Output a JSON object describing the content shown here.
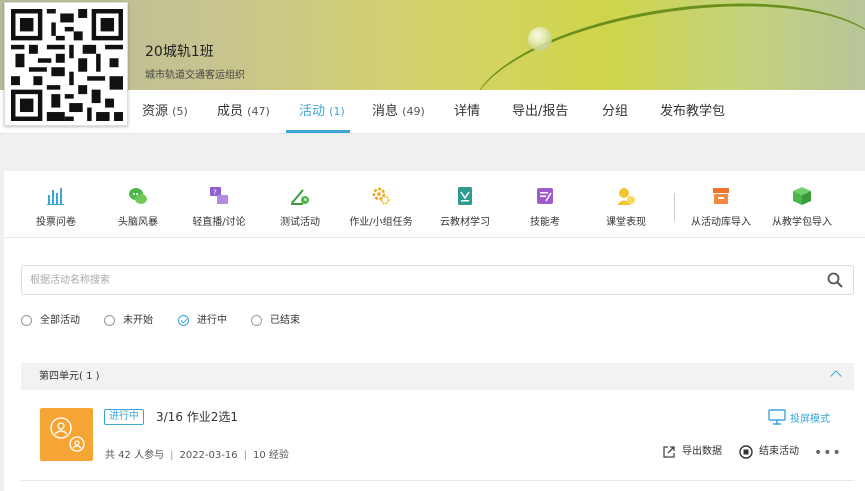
{
  "course": {
    "class_name": "20城轨1班",
    "subtitle": "城市轨道交通客运组织"
  },
  "nav": [
    {
      "label": "资源",
      "count": "(5)"
    },
    {
      "label": "成员",
      "count": "(47)"
    },
    {
      "label": "活动",
      "count": "(1)"
    },
    {
      "label": "消息",
      "count": "(49)"
    },
    {
      "label": "详情",
      "count": ""
    },
    {
      "label": "导出/报告",
      "count": ""
    },
    {
      "label": "分组",
      "count": ""
    },
    {
      "label": "发布教学包",
      "count": ""
    }
  ],
  "active_nav": "活动",
  "tools": [
    {
      "label": "投票问卷",
      "icon": "vote-icon"
    },
    {
      "label": "头脑风暴",
      "icon": "brainstorm-icon"
    },
    {
      "label": "轻直播/讨论",
      "icon": "live-discussion-icon"
    },
    {
      "label": "测试活动",
      "icon": "test-icon"
    },
    {
      "label": "作业/小组任务",
      "icon": "homework-icon"
    },
    {
      "label": "云教材学习",
      "icon": "cloud-textbook-icon"
    },
    {
      "label": "技能考",
      "icon": "skill-exam-icon"
    },
    {
      "label": "课堂表现",
      "icon": "class-performance-icon"
    },
    {
      "label": "从活动库导入",
      "icon": "activity-library-icon"
    },
    {
      "label": "从教学包导入",
      "icon": "teaching-package-icon"
    }
  ],
  "search": {
    "placeholder": "根据活动名称搜索"
  },
  "filters": [
    {
      "label": "全部活动",
      "checked": false
    },
    {
      "label": "未开始",
      "checked": false
    },
    {
      "label": "进行中",
      "checked": true
    },
    {
      "label": "已结束",
      "checked": false
    }
  ],
  "unit": {
    "title": "第四单元( 1 )"
  },
  "activity": {
    "status": "进行中",
    "title": "3/16 作业2选1",
    "participants": "共 42 人参与",
    "date": "2022-03-16",
    "exp": "10 经验",
    "screen_mode": "投屏模式",
    "export": "导出数据",
    "end": "结束活动",
    "more": "•••"
  },
  "colors": {
    "accent": "#3aa5d8",
    "activity_icon": "#f5a533"
  }
}
